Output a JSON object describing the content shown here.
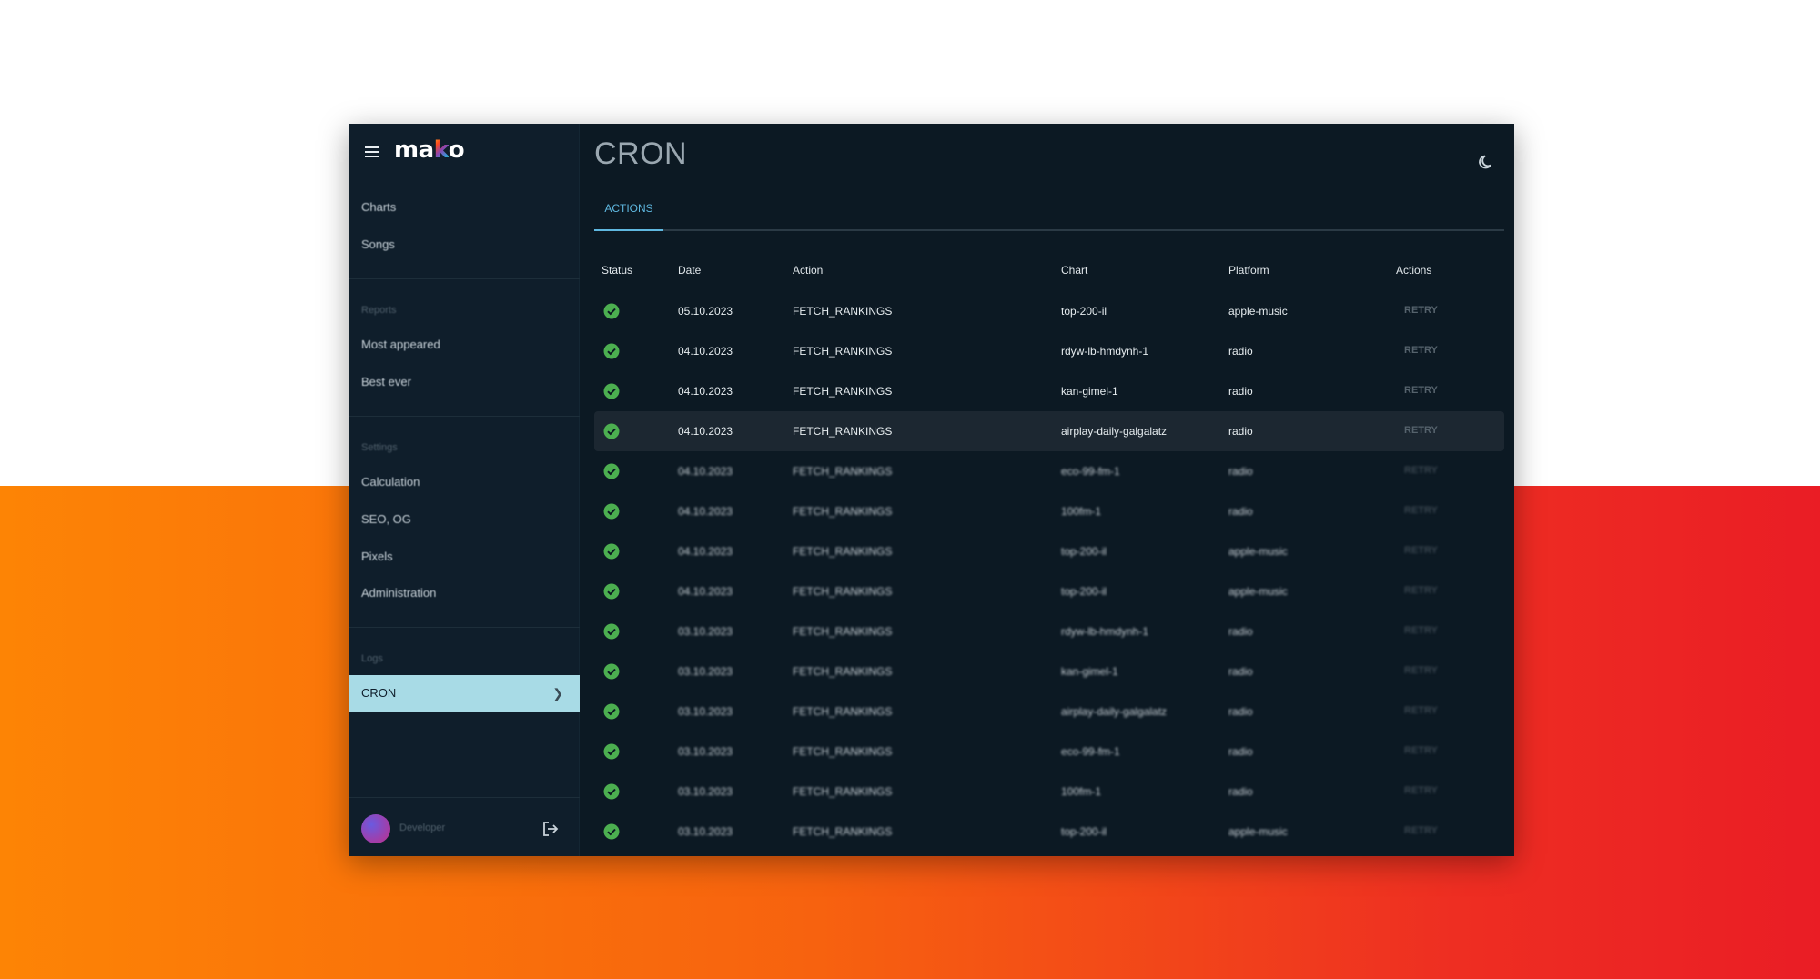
{
  "app": {
    "logo": "mako"
  },
  "sidebar": {
    "items": [
      {
        "label": "Charts"
      },
      {
        "label": "Songs"
      }
    ],
    "reports": {
      "heading": "Reports",
      "items": [
        {
          "label": "Most appeared"
        },
        {
          "label": "Best ever"
        }
      ]
    },
    "settings": {
      "heading": "Settings",
      "items": [
        {
          "label": "Calculation"
        },
        {
          "label": "SEO, OG"
        },
        {
          "label": "Pixels"
        },
        {
          "label": "Administration"
        }
      ]
    },
    "logs": {
      "heading": "Logs",
      "active_item": "CRON"
    },
    "user": {
      "name": "Developer"
    }
  },
  "page": {
    "title": "CRON"
  },
  "tabs": [
    {
      "label": "ACTIONS",
      "active": true
    }
  ],
  "table": {
    "headers": [
      "Status",
      "Date",
      "Action",
      "Chart",
      "Platform",
      "Actions"
    ],
    "rows": [
      {
        "date": "05.10.2023",
        "action": "FETCH_RANKINGS",
        "chart": "top-200-il",
        "platform": "apple-music",
        "button": "RETRY"
      },
      {
        "date": "04.10.2023",
        "action": "FETCH_RANKINGS",
        "chart": "rdyw-lb-hmdynh-1",
        "platform": "radio",
        "button": "RETRY"
      },
      {
        "date": "04.10.2023",
        "action": "FETCH_RANKINGS",
        "chart": "kan-gimel-1",
        "platform": "radio",
        "button": "RETRY"
      },
      {
        "date": "04.10.2023",
        "action": "FETCH_RANKINGS",
        "chart": "airplay-daily-galgalatz",
        "platform": "radio",
        "button": "RETRY"
      },
      {
        "date": "04.10.2023",
        "action": "FETCH_RANKINGS",
        "chart": "eco-99-fm-1",
        "platform": "radio",
        "button": "RETRY"
      },
      {
        "date": "04.10.2023",
        "action": "FETCH_RANKINGS",
        "chart": "100fm-1",
        "platform": "radio",
        "button": "RETRY"
      },
      {
        "date": "04.10.2023",
        "action": "FETCH_RANKINGS",
        "chart": "top-200-il",
        "platform": "apple-music",
        "button": "RETRY"
      },
      {
        "date": "04.10.2023",
        "action": "FETCH_RANKINGS",
        "chart": "top-200-il",
        "platform": "apple-music",
        "button": "RETRY"
      },
      {
        "date": "03.10.2023",
        "action": "FETCH_RANKINGS",
        "chart": "rdyw-lb-hmdynh-1",
        "platform": "radio",
        "button": "RETRY"
      },
      {
        "date": "03.10.2023",
        "action": "FETCH_RANKINGS",
        "chart": "kan-gimel-1",
        "platform": "radio",
        "button": "RETRY"
      },
      {
        "date": "03.10.2023",
        "action": "FETCH_RANKINGS",
        "chart": "airplay-daily-galgalatz",
        "platform": "radio",
        "button": "RETRY"
      },
      {
        "date": "03.10.2023",
        "action": "FETCH_RANKINGS",
        "chart": "eco-99-fm-1",
        "platform": "radio",
        "button": "RETRY"
      },
      {
        "date": "03.10.2023",
        "action": "FETCH_RANKINGS",
        "chart": "100fm-1",
        "platform": "radio",
        "button": "RETRY"
      },
      {
        "date": "03.10.2023",
        "action": "FETCH_RANKINGS",
        "chart": "top-200-il",
        "platform": "apple-music",
        "button": "RETRY"
      }
    ]
  },
  "colors": {
    "status_ok": "#4caf50",
    "accent": "#5fb8e0",
    "active_nav": "#a8dbe6"
  }
}
